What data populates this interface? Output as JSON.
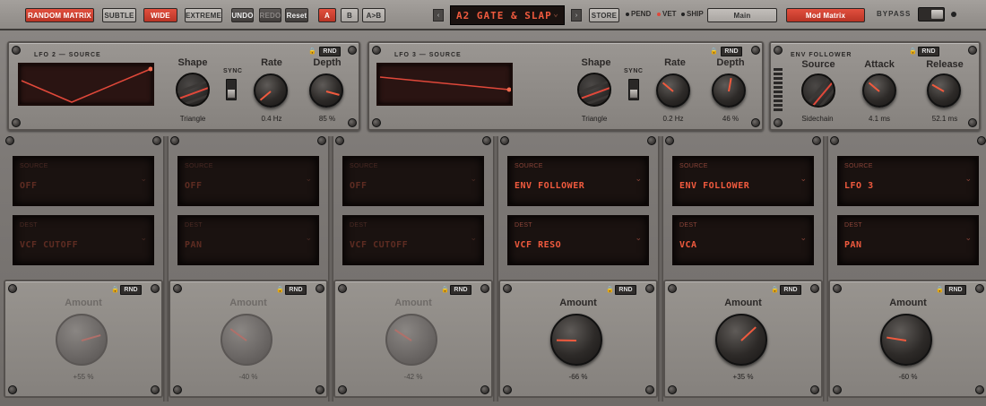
{
  "topbar": {
    "random_matrix": "RANDOM MATRIX",
    "subtle": "SUBTLE",
    "wide": "WIDE",
    "extreme": "EXTREME",
    "undo": "UNDO",
    "redo": "REDO",
    "reset": "Reset",
    "a": "A",
    "b": "B",
    "atob": "A>B",
    "prev": "‹",
    "next": "›",
    "preset": "A2 GATE & SLAP",
    "store": "STORE",
    "pend": "PEND",
    "vet": "VET",
    "ship": "SHIP",
    "main_tab": "Main",
    "mod_tab": "Mod Matrix",
    "bypass": "BYPASS",
    "accent": "#e2503f"
  },
  "lfo2": {
    "title": "LFO 2 — SOURCE",
    "rnd": "RND",
    "shape_label": "Shape",
    "shape_value": "Triangle",
    "sync_label": "SYNC",
    "rate_label": "Rate",
    "rate_value": "0.4 Hz",
    "depth_label": "Depth",
    "depth_value": "85 %"
  },
  "lfo3": {
    "title": "LFO 3 — SOURCE",
    "rnd": "RND",
    "shape_label": "Shape",
    "shape_value": "Triangle",
    "sync_label": "SYNC",
    "rate_label": "Rate",
    "rate_value": "0.2 Hz",
    "depth_label": "Depth",
    "depth_value": "46 %"
  },
  "env": {
    "title": "ENV FOLLOWER",
    "rnd": "RND",
    "source_label": "Source",
    "source_value": "Sidechain",
    "attack_label": "Attack",
    "attack_value": "4.1 ms",
    "release_label": "Release",
    "release_value": "52.1 ms"
  },
  "slots": [
    {
      "source_cap": "SOURCE",
      "source": "OFF",
      "dest_cap": "DEST",
      "dest": "VCF CUTOFF",
      "rnd": "RND",
      "amount_label": "Amount",
      "amount_value": "+55 %",
      "amount_pct": 55,
      "active": false
    },
    {
      "source_cap": "SOURCE",
      "source": "OFF",
      "dest_cap": "DEST",
      "dest": "PAN",
      "rnd": "RND",
      "amount_label": "Amount",
      "amount_value": "-40 %",
      "amount_pct": -40,
      "active": false
    },
    {
      "source_cap": "SOURCE",
      "source": "OFF",
      "dest_cap": "DEST",
      "dest": "VCF CUTOFF",
      "rnd": "RND",
      "amount_label": "Amount",
      "amount_value": "-42 %",
      "amount_pct": -42,
      "active": false
    },
    {
      "source_cap": "SOURCE",
      "source": "ENV FOLLOWER",
      "dest_cap": "DEST",
      "dest": "VCF RESO",
      "rnd": "RND",
      "amount_label": "Amount",
      "amount_value": "-66 %",
      "amount_pct": -66,
      "active": true
    },
    {
      "source_cap": "SOURCE",
      "source": "ENV FOLLOWER",
      "dest_cap": "DEST",
      "dest": "VCA",
      "rnd": "RND",
      "amount_label": "Amount",
      "amount_value": "+35 %",
      "amount_pct": 35,
      "active": true
    },
    {
      "source_cap": "SOURCE",
      "source": "LFO 3",
      "dest_cap": "DEST",
      "dest": "PAN",
      "rnd": "RND",
      "amount_label": "Amount",
      "amount_value": "-60 %",
      "amount_pct": -60,
      "active": true
    }
  ]
}
